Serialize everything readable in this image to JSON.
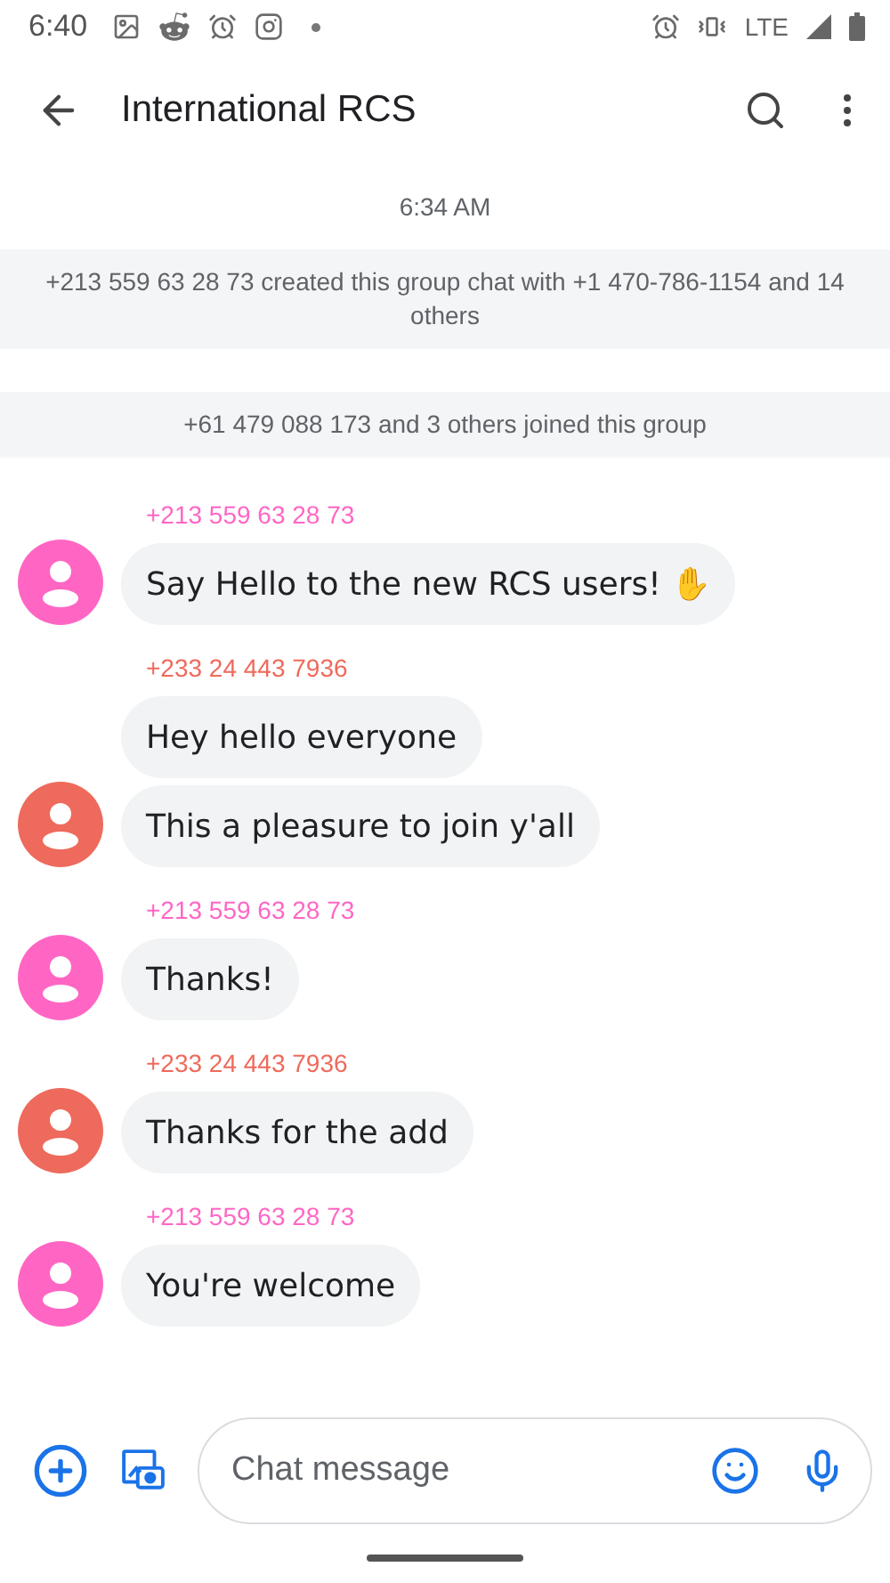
{
  "status_bar": {
    "time": "6:40",
    "network": "LTE"
  },
  "header": {
    "title": "International RCS"
  },
  "timestamp": "6:34 AM",
  "events": [
    "+213 559 63 28 73 created this group chat with +1 470-786-1154 and 14 others",
    "+61 479 088 173 and 3 others joined this group"
  ],
  "groups": [
    {
      "sender": "+213 559 63 28 73",
      "color": "#ff66c4",
      "messages": [
        "Say Hello to the new RCS users! ✋"
      ]
    },
    {
      "sender": "+233 24 443 7936",
      "color": "#ee6a5c",
      "messages": [
        "Hey hello everyone",
        "This a pleasure to join y'all"
      ]
    },
    {
      "sender": "+213 559 63 28 73",
      "color": "#ff66c4",
      "messages": [
        "Thanks!"
      ]
    },
    {
      "sender": "+233 24 443 7936",
      "color": "#ee6a5c",
      "messages": [
        "Thanks for the add"
      ]
    },
    {
      "sender": "+213 559 63 28 73",
      "color": "#ff66c4",
      "messages": [
        "You're welcome"
      ]
    }
  ],
  "composer": {
    "placeholder": "Chat message"
  }
}
